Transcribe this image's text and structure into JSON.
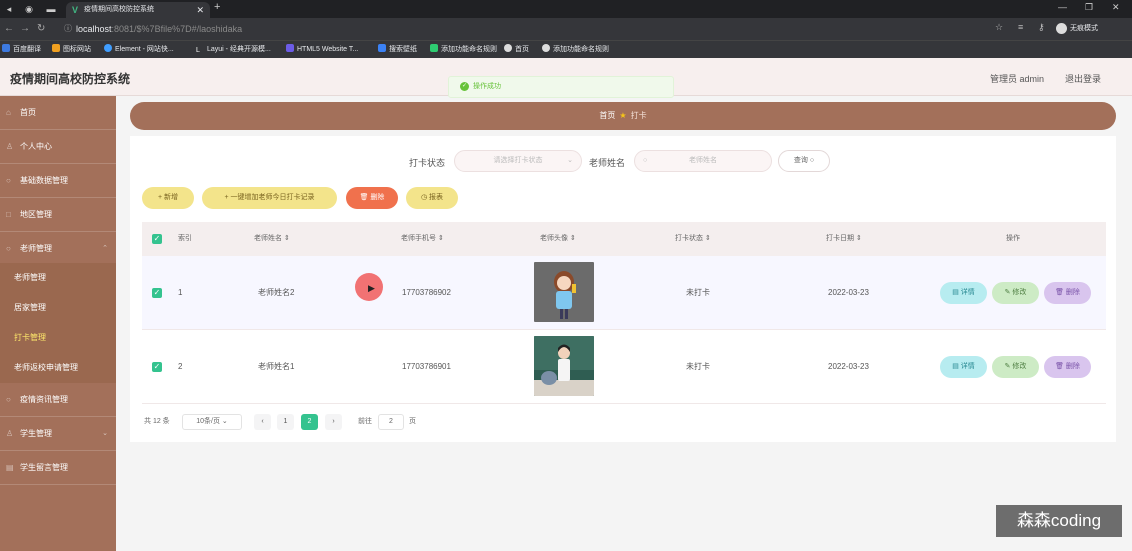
{
  "browser": {
    "tab_title": "疫情期间高校防控系统",
    "url_host": "localhost",
    "url_path": ":8081/$%7Bfile%7D#/laoshidaka",
    "profile_label": "无痕模式",
    "bookmarks": [
      "百度翻译",
      "图标网站",
      "Element - 网站快...",
      "Layui - 经典开源模...",
      "HTML5 Website T...",
      "搜索壁纸",
      "添加功能命名规则",
      "首页",
      "添加功能命名规则"
    ]
  },
  "header": {
    "title": "疫情期间高校防控系统",
    "admin": "管理员 admin",
    "logout": "退出登录"
  },
  "toast": {
    "message": "操作成功"
  },
  "sidebar": {
    "items": [
      {
        "label": "首页"
      },
      {
        "label": "个人中心"
      },
      {
        "label": "基础数据管理"
      },
      {
        "label": "地区管理"
      },
      {
        "label": "老师管理"
      }
    ],
    "sub_items": [
      {
        "label": "老师管理"
      },
      {
        "label": "居家管理"
      },
      {
        "label": "打卡管理"
      },
      {
        "label": "老师返校申请管理"
      }
    ],
    "items_after": [
      {
        "label": "疫情资讯管理"
      },
      {
        "label": "学生管理"
      },
      {
        "label": "学生留言管理"
      }
    ]
  },
  "breadcrumb": {
    "home": "首页",
    "current": "打卡"
  },
  "search": {
    "status_label": "打卡状态",
    "status_placeholder": "请选择打卡状态",
    "name_label": "老师姓名",
    "name_placeholder": "老师姓名",
    "search_button": "查询"
  },
  "actions": {
    "add": "+ 新增",
    "punch_all": "+ 一键增加老师今日打卡记录",
    "delete": "删除",
    "report": "报表"
  },
  "table": {
    "headers": [
      "索引",
      "老师姓名",
      "老师手机号",
      "老师头像",
      "打卡状态",
      "打卡日期",
      "操作"
    ],
    "rows": [
      {
        "index": "1",
        "name": "老师姓名2",
        "phone": "17703786902",
        "status": "未打卡",
        "date": "2022-03-23"
      },
      {
        "index": "2",
        "name": "老师姓名1",
        "phone": "17703786901",
        "status": "未打卡",
        "date": "2022-03-23"
      }
    ],
    "row_buttons": {
      "detail": "详情",
      "edit": "修改",
      "delete": "删除"
    }
  },
  "pager": {
    "total": "共 12 条",
    "page_size": "10条/页",
    "pages": [
      "1",
      "2"
    ],
    "current_page": "2",
    "goto_label": "前往",
    "goto_value": "2",
    "page_suffix": "页"
  },
  "watermark": "森森coding",
  "colors": {
    "sidebar": "#a3705a",
    "accent_green": "#34c38f",
    "yellow_button": "#f3e48b",
    "red_button": "#f0714d"
  }
}
